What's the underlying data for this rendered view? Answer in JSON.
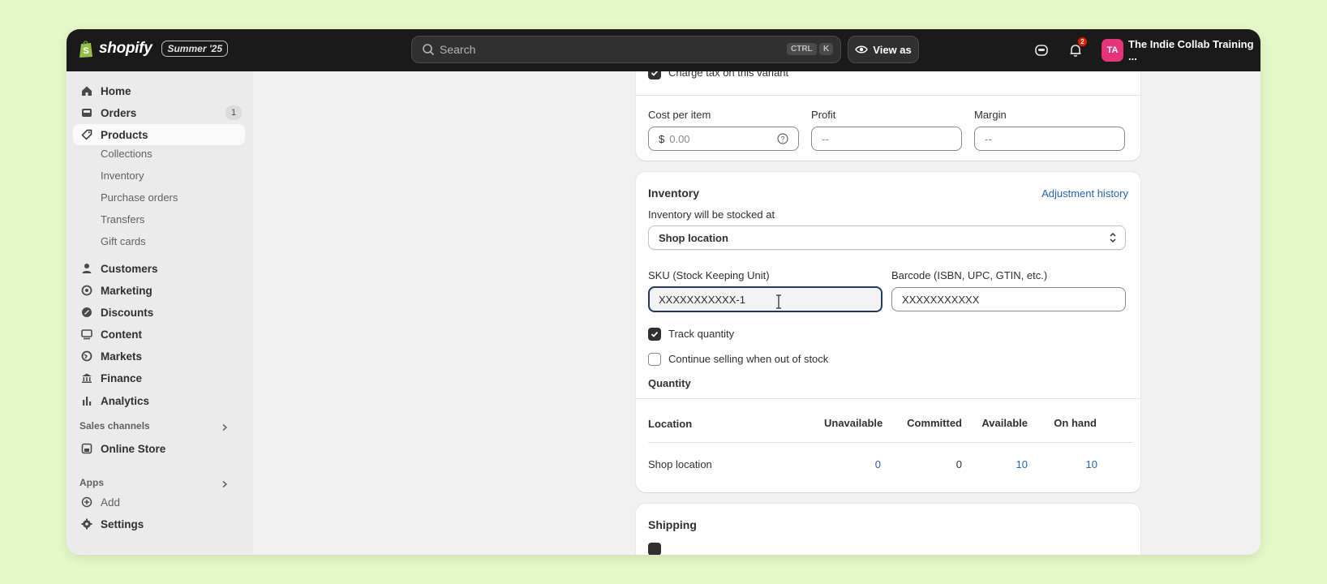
{
  "topbar": {
    "brand": "shopify",
    "edition": "Summer '25",
    "search_placeholder": "Search",
    "kbd_ctrl": "CTRL",
    "kbd_k": "K",
    "view_as": "View as",
    "notification_count": "2",
    "avatar_initials": "TA",
    "store_name": "The Indie Collab Training ..."
  },
  "sidebar": {
    "items": [
      {
        "label": "Home",
        "icon": "home-icon"
      },
      {
        "label": "Orders",
        "icon": "inbox-icon",
        "count": "1"
      },
      {
        "label": "Products",
        "icon": "tag-icon"
      }
    ],
    "product_subitems": [
      "Collections",
      "Inventory",
      "Purchase orders",
      "Transfers",
      "Gift cards"
    ],
    "items2": [
      {
        "label": "Customers",
        "icon": "person-icon"
      },
      {
        "label": "Marketing",
        "icon": "target-icon"
      },
      {
        "label": "Discounts",
        "icon": "discount-icon"
      },
      {
        "label": "Content",
        "icon": "content-icon"
      },
      {
        "label": "Markets",
        "icon": "globe-icon"
      },
      {
        "label": "Finance",
        "icon": "bank-icon"
      },
      {
        "label": "Analytics",
        "icon": "bar-chart-icon"
      }
    ],
    "sales_channels_label": "Sales channels",
    "online_store": "Online Store",
    "apps_label": "Apps",
    "add_label": "Add",
    "settings_label": "Settings"
  },
  "pricing": {
    "charge_tax_label": "Charge tax on this variant",
    "cost_label": "Cost per item",
    "cost_prefix": "$",
    "cost_placeholder": "0.00",
    "profit_label": "Profit",
    "profit_value": "--",
    "margin_label": "Margin",
    "margin_value": "--"
  },
  "inventory": {
    "title": "Inventory",
    "adjustment_history": "Adjustment history",
    "stocked_at_label": "Inventory will be stocked at",
    "location_select": "Shop location",
    "sku_label": "SKU (Stock Keeping Unit)",
    "sku_value": "XXXXXXXXXXX-1",
    "barcode_label": "Barcode (ISBN, UPC, GTIN, etc.)",
    "barcode_value": "XXXXXXXXXXX",
    "track_quantity": "Track quantity",
    "continue_selling": "Continue selling when out of stock",
    "quantity_title": "Quantity",
    "table": {
      "headers": [
        "Location",
        "Unavailable",
        "Committed",
        "Available",
        "On hand"
      ],
      "rows": [
        {
          "location": "Shop location",
          "unavailable": "0",
          "committed": "0",
          "available": "10",
          "on_hand": "10"
        }
      ]
    }
  },
  "shipping": {
    "title": "Shipping"
  }
}
